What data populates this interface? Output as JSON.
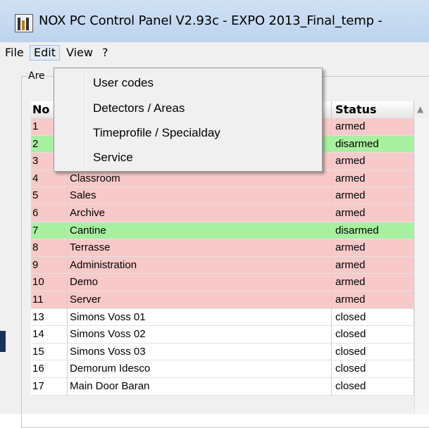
{
  "window": {
    "title": "NOX PC Control Panel V2.93c - EXPO 2013_Final_temp -"
  },
  "menubar": {
    "file": "File",
    "edit": "Edit",
    "view": "View",
    "help": "?"
  },
  "edit_menu": {
    "items": [
      "User codes",
      "Detectors / Areas",
      "Timeprofile / Specialday",
      "Service"
    ]
  },
  "group": {
    "label": "Are"
  },
  "table": {
    "headers": {
      "no": "No",
      "status": "Status"
    },
    "rows": [
      {
        "no": "1",
        "name": "",
        "status": "armed",
        "state": "armed"
      },
      {
        "no": "2",
        "name": "",
        "status": "disarmed",
        "state": "disarmed"
      },
      {
        "no": "3",
        "name": "",
        "status": "armed",
        "state": "armed"
      },
      {
        "no": "4",
        "name": "Classroom",
        "status": "armed",
        "state": "armed"
      },
      {
        "no": "5",
        "name": "Sales",
        "status": "armed",
        "state": "armed"
      },
      {
        "no": "6",
        "name": "Archive",
        "status": "armed",
        "state": "armed"
      },
      {
        "no": "7",
        "name": "Cantine",
        "status": "disarmed",
        "state": "disarmed"
      },
      {
        "no": "8",
        "name": "Terrasse",
        "status": "armed",
        "state": "armed"
      },
      {
        "no": "9",
        "name": "Administration",
        "status": "armed",
        "state": "armed"
      },
      {
        "no": "10",
        "name": "Demo",
        "status": "armed",
        "state": "armed"
      },
      {
        "no": "11",
        "name": "Server",
        "status": "armed",
        "state": "armed"
      },
      {
        "no": "13",
        "name": "Simons Voss 01",
        "status": "closed",
        "state": "closed"
      },
      {
        "no": "14",
        "name": "Simons Voss 02",
        "status": "closed",
        "state": "closed"
      },
      {
        "no": "15",
        "name": "Simons Voss 03",
        "status": "closed",
        "state": "closed"
      },
      {
        "no": "16",
        "name": "Demorum Idesco",
        "status": "closed",
        "state": "closed"
      },
      {
        "no": "17",
        "name": "Main Door Baran",
        "status": "closed",
        "state": "closed"
      }
    ]
  },
  "colors": {
    "armed": "#f8c9c9",
    "disarmed": "#a8f0a0",
    "closed": "#ffffff"
  },
  "icons": {
    "app": "app-logo-icon",
    "scroll_up": "scroll-up-arrow-icon"
  }
}
